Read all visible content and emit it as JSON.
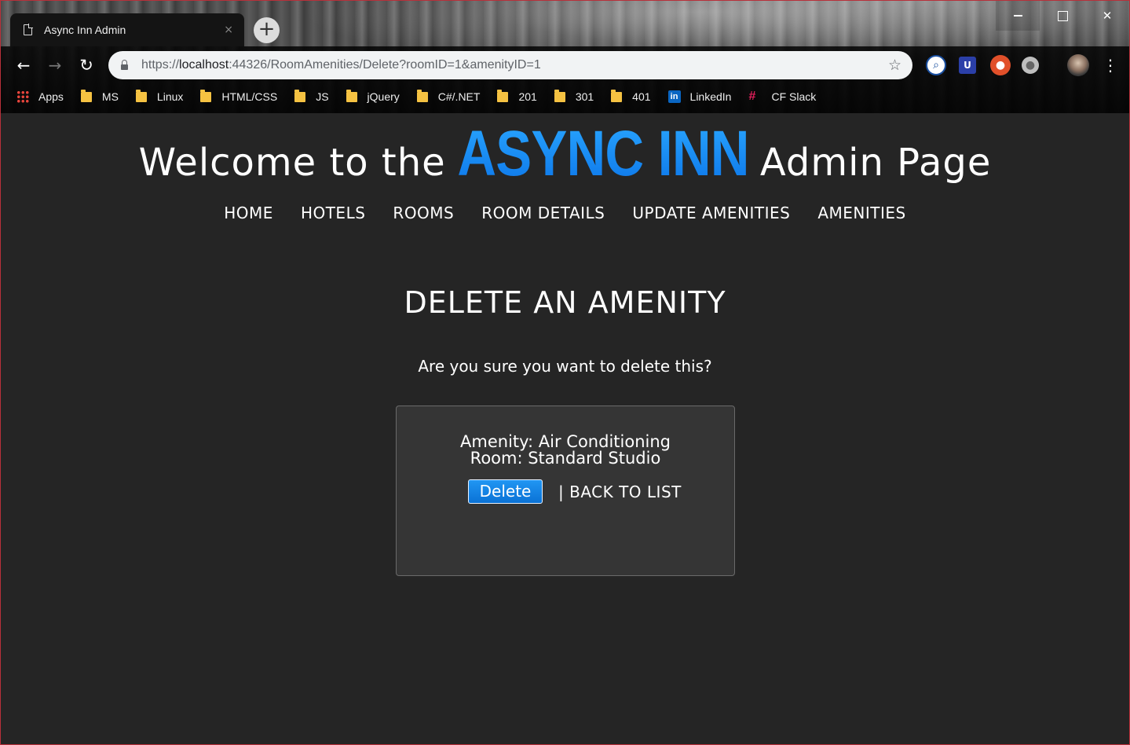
{
  "browser": {
    "tab_title": "Async Inn Admin",
    "tab_close": "×",
    "new_tab": "+",
    "url_prefix": "https://",
    "url_host": "localhost",
    "url_rest": ":44326/RoomAmenities/Delete?roomID=1&amenityID=1",
    "bookmarks": {
      "apps": "Apps",
      "ms": "MS",
      "linux": "Linux",
      "htmlcss": "HTML/CSS",
      "js": "JS",
      "jquery": "jQuery",
      "csharp": "C#/.NET",
      "b201": "201",
      "b301": "301",
      "b401": "401",
      "linkedin": "LinkedIn",
      "cfslack": "CF Slack"
    }
  },
  "site": {
    "title_before": "Welcome to the",
    "brand": "ASYNC INN",
    "title_after": "Admin Page",
    "brand_color": "#1e90ff",
    "nav": {
      "home": "HOME",
      "hotels": "HOTELS",
      "rooms": "ROOMS",
      "room_details": "ROOM DETAILS",
      "update_amenities": "UPDATE AMENITIES",
      "amenities": "AMENITIES"
    }
  },
  "main": {
    "heading": "DELETE AN AMENITY",
    "question": "Are you sure you want to delete this?",
    "amenity_line": "Amenity: Air Conditioning",
    "room_line": "Room: Standard Studio",
    "delete_label": "Delete",
    "back_label": "| BACK TO LIST"
  }
}
